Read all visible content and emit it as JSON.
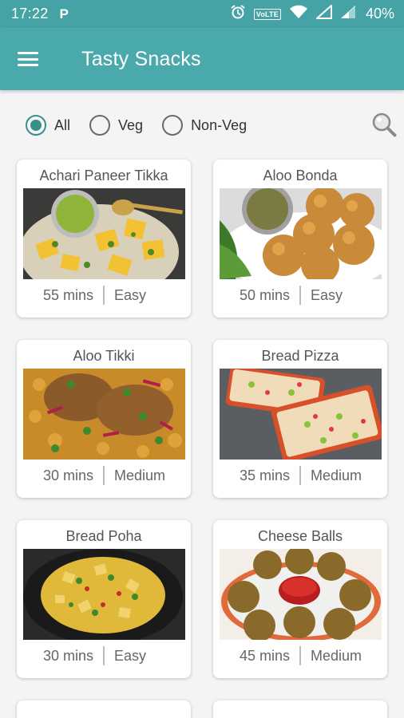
{
  "status_bar": {
    "time": "17:22",
    "app_indicator": "P",
    "network_label": "VoLTE",
    "battery": "40%"
  },
  "app_bar": {
    "title": "Tasty Snacks"
  },
  "filters": {
    "options": [
      "All",
      "Veg",
      "Non-Veg"
    ],
    "selected": "All"
  },
  "recipes": [
    {
      "name": "Achari Paneer Tikka",
      "time": "55 mins",
      "difficulty": "Easy"
    },
    {
      "name": "Aloo Bonda",
      "time": "50 mins",
      "difficulty": "Easy"
    },
    {
      "name": "Aloo Tikki",
      "time": "30 mins",
      "difficulty": "Medium"
    },
    {
      "name": "Bread Pizza",
      "time": "35 mins",
      "difficulty": "Medium"
    },
    {
      "name": "Bread Poha",
      "time": "30 mins",
      "difficulty": "Easy"
    },
    {
      "name": "Cheese Balls",
      "time": "45 mins",
      "difficulty": "Medium"
    }
  ],
  "colors": {
    "primary": "#4aa9ab",
    "status_bar": "#46a3a5",
    "accent": "#3a8f8a"
  }
}
